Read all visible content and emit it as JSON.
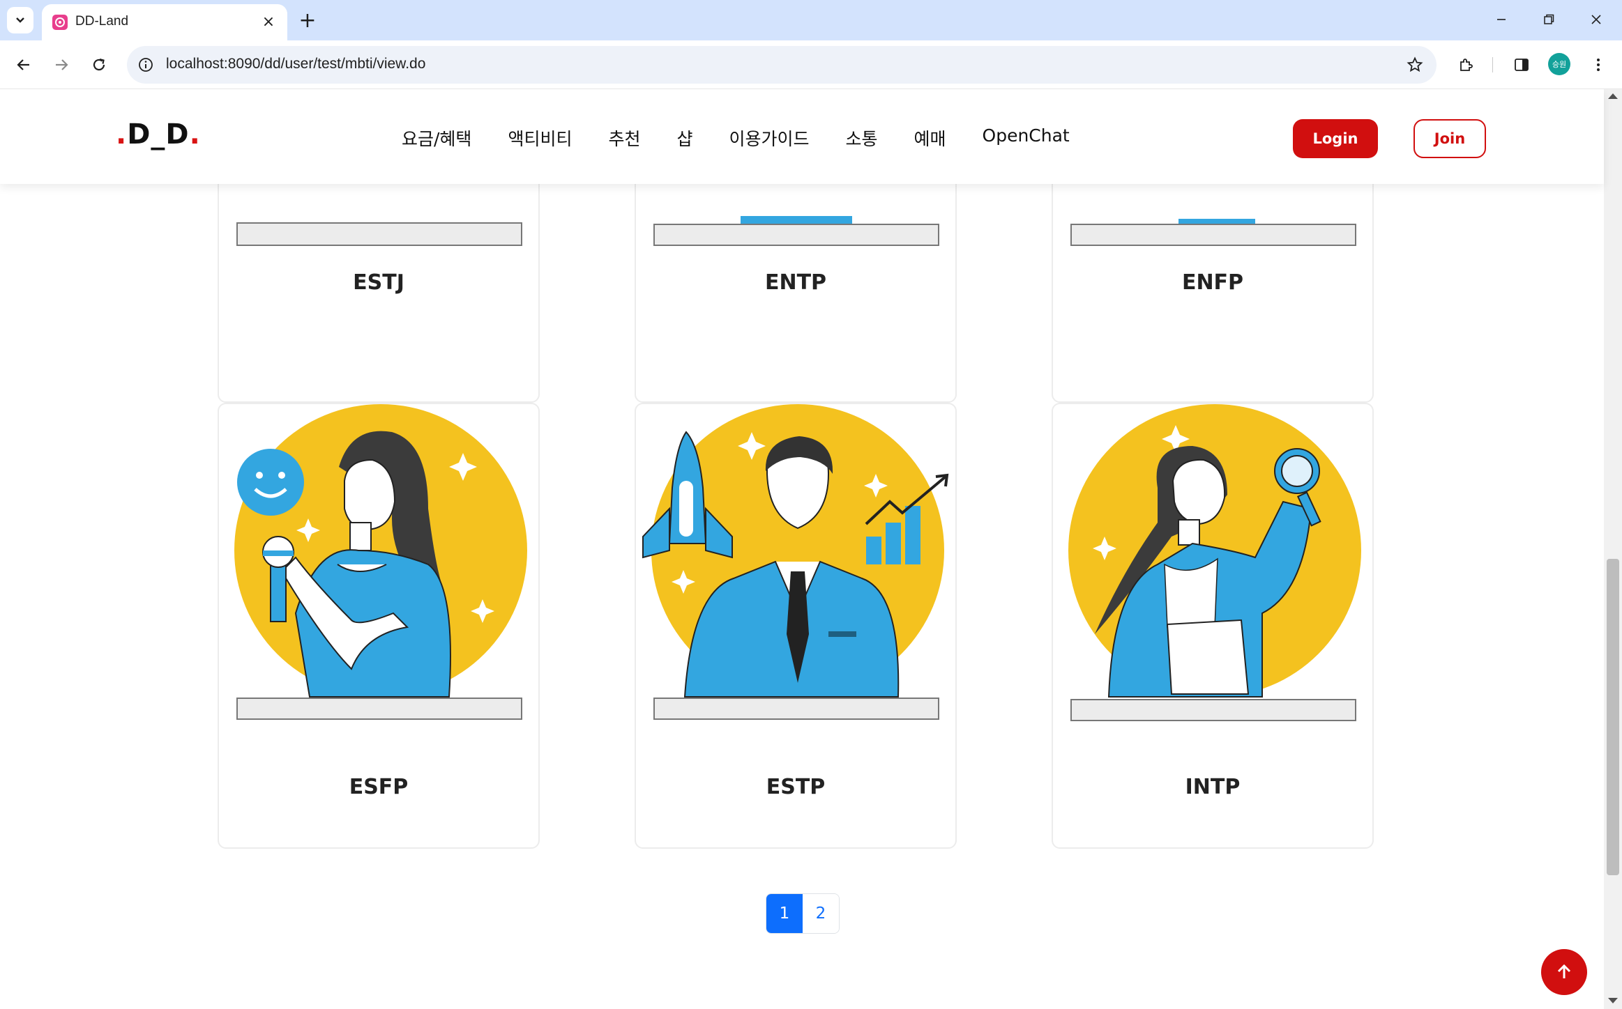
{
  "browser": {
    "tab_title": "DD-Land",
    "url": "localhost:8090/dd/user/test/mbti/view.do",
    "profile_initials": "승원"
  },
  "header": {
    "logo": {
      "dot1": ".",
      "text": "D_D",
      "dot2": "."
    },
    "menu": [
      "요금/혜택",
      "액티비티",
      "추천",
      "샵",
      "이용가이드",
      "소통",
      "예매",
      "OpenChat"
    ],
    "login_label": "Login",
    "join_label": "Join"
  },
  "cards_top": [
    {
      "type": "ESTJ"
    },
    {
      "type": "ENTP"
    },
    {
      "type": "ENFP"
    }
  ],
  "cards_bottom": [
    {
      "type": "ESFP"
    },
    {
      "type": "ESTP"
    },
    {
      "type": "INTP"
    }
  ],
  "pagination": {
    "pages": [
      "1",
      "2"
    ],
    "current": "1"
  },
  "colors": {
    "brand_red": "#d10f0f",
    "illustration_yellow": "#f4c21f",
    "illustration_blue": "#33a6e0",
    "page_blue": "#0d6efd"
  },
  "icons": {
    "to_top": "arrow-up-icon"
  }
}
